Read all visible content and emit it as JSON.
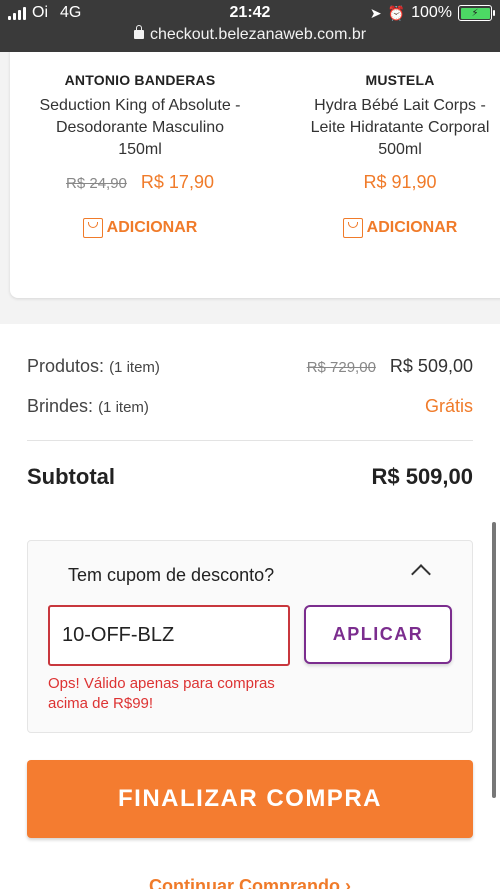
{
  "status_bar": {
    "carrier": "Oi",
    "network": "4G",
    "time": "21:42",
    "battery": "100%",
    "url": "checkout.belezanaweb.com.br"
  },
  "products": [
    {
      "brand": "ANTONIO BANDERAS",
      "name": "Seduction King of Absolute -\nDesodorante Masculino\n150ml",
      "old_price": "R$ 24,90",
      "price": "R$ 17,90",
      "add_label": "ADICIONAR"
    },
    {
      "brand": "MUSTELA",
      "name": "Hydra Bébé Lait Corps -\nLeite Hidratante Corporal\n500ml",
      "old_price": "",
      "price": "R$ 91,90",
      "add_label": "ADICIONAR"
    }
  ],
  "summary": {
    "products_label": "Produtos:",
    "products_count": "(1 item)",
    "products_old": "R$ 729,00",
    "products_value": "R$ 509,00",
    "gifts_label": "Brindes:",
    "gifts_count": "(1 item)",
    "gifts_value": "Grátis",
    "subtotal_label": "Subtotal",
    "subtotal_value": "R$ 509,00"
  },
  "coupon": {
    "title": "Tem cupom de desconto?",
    "value": "10-OFF-BLZ",
    "apply_label": "APLICAR",
    "error": "Ops! Válido apenas para compras acima de R$99!"
  },
  "actions": {
    "finalize_label": "FINALIZAR COMPRA",
    "continue_label": "Continuar Comprando ›"
  },
  "colors": {
    "accent": "#f07b2a",
    "purple": "#7b2d8e",
    "error": "#d33333"
  }
}
